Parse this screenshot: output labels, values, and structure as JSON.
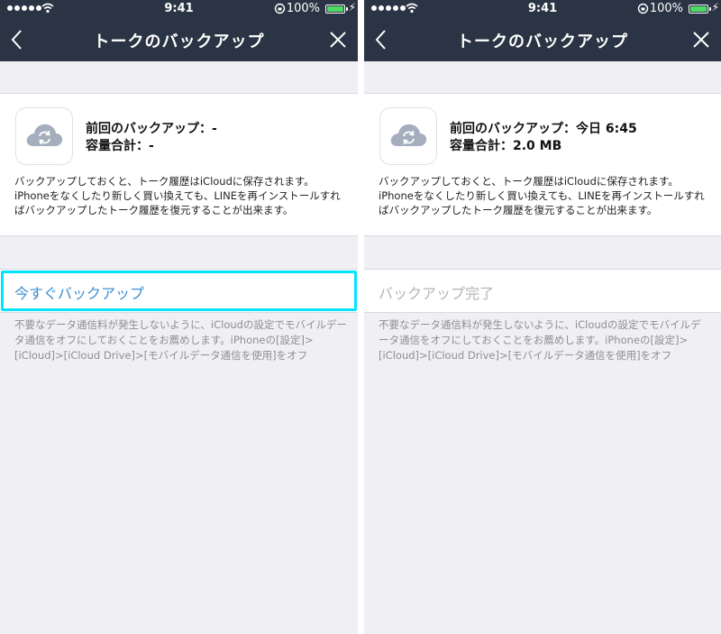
{
  "screens": [
    {
      "status": {
        "time": "9:41",
        "battery": "100%"
      },
      "title": "トークのバックアップ",
      "last_backup_label": "前回のバックアップ：",
      "last_backup_value": "-",
      "capacity_label": "容量合計：",
      "capacity_value": "-",
      "description": "バックアップしておくと、トーク履歴はiCloudに保存されます。iPhoneをなくしたり新しく買い換えても、LINEを再インストールすればバックアップしたトーク履歴を復元することが出来ます。",
      "action_label": "今すぐバックアップ",
      "note": "不要なデータ通信料が発生しないように、iCloudの設定でモバイルデータ通信をオフにしておくことをお薦めします。iPhoneの[設定]>[iCloud]>[iCloud Drive]>[モバイルデータ通信を使用]をオフ"
    },
    {
      "status": {
        "time": "9:41",
        "battery": "100%"
      },
      "title": "トークのバックアップ",
      "last_backup_label": "前回のバックアップ：",
      "last_backup_value": "今日 6:45",
      "capacity_label": "容量合計：",
      "capacity_value": "2.0 MB",
      "description": "バックアップしておくと、トーク履歴はiCloudに保存されます。iPhoneをなくしたり新しく買い換えても、LINEを再インストールすればバックアップしたトーク履歴を復元することが出来ます。",
      "action_label": "バックアップ完了",
      "note": "不要なデータ通信料が発生しないように、iCloudの設定でモバイルデータ通信をオフにしておくことをお薦めします。iPhoneの[設定]>[iCloud]>[iCloud Drive]>[モバイルデータ通信を使用]をオフ"
    }
  ],
  "icons": {
    "signal": "signal-dots-icon",
    "wifi": "wifi-icon",
    "rotation_lock": "rotation-lock-icon",
    "battery": "battery-icon",
    "charging": "charging-bolt-icon",
    "back": "chevron-left-icon",
    "close": "close-icon",
    "cloud": "icloud-sync-icon"
  },
  "colors": {
    "nav_bar": "#2b3444",
    "background": "#efeff4",
    "action_active": "#3c8fd6",
    "action_disabled": "#b4b4b8",
    "highlight": "#00e5ff",
    "battery_fill": "#4cd964"
  }
}
